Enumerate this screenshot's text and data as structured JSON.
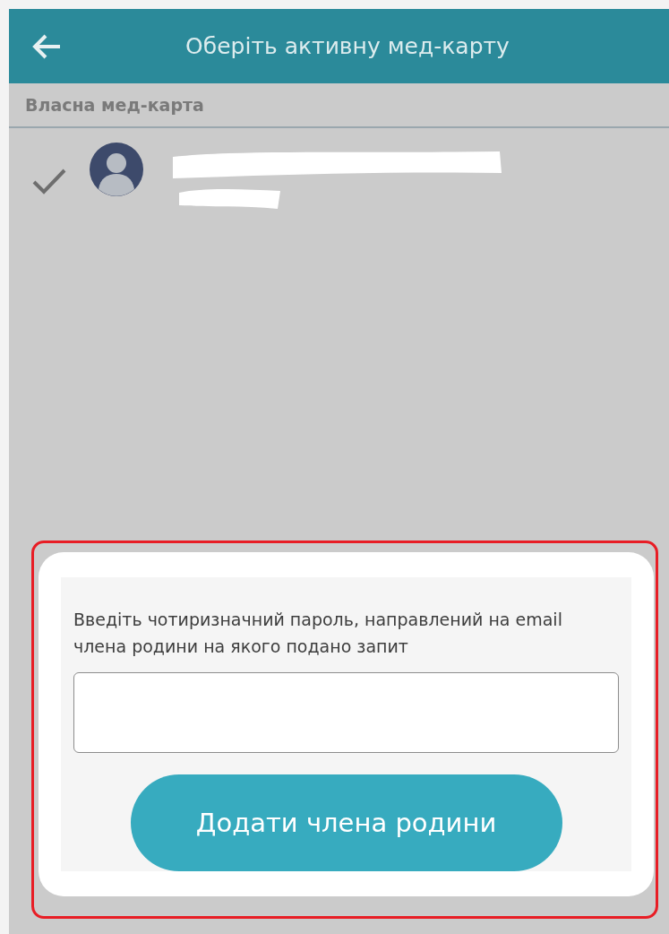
{
  "app_bar": {
    "title": "Оберіть активну мед-карту"
  },
  "section": {
    "title": "Власна мед-карта"
  },
  "cards": [
    {
      "selected": true,
      "redacted": true
    }
  ],
  "dialog": {
    "highlighted": true,
    "prompt": "Введіть чотиризначний пароль, направлений на email члена родини на якого подано запит",
    "button": "Додати члена родини"
  }
}
